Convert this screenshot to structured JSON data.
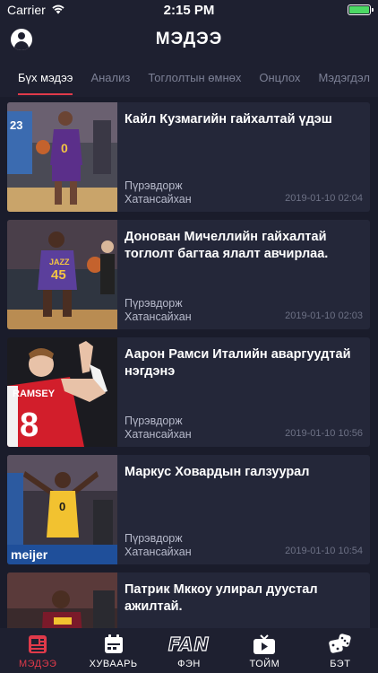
{
  "status": {
    "carrier": "Carrier",
    "time": "2:15 PM"
  },
  "header": {
    "title": "МЭДЭЭ"
  },
  "tabs": [
    {
      "label": "Бүх мэдээ"
    },
    {
      "label": "Анализ"
    },
    {
      "label": "Тоглолтын өмнөх"
    },
    {
      "label": "Онцлох"
    },
    {
      "label": "Мэдэгдэл"
    }
  ],
  "feed": [
    {
      "title": "Кайл Кузмагийн гайхалтай үдэш",
      "author_1": "Пүрэвдорж",
      "author_2": "Хатансайхан",
      "date": "2019-01-10 02:04"
    },
    {
      "title": "Донован Мичеллийн гайхалтай тоглолт багтаа ялалт авчирлаа.",
      "author_1": "Пүрэвдорж",
      "author_2": "Хатансайхан",
      "date": "2019-01-10 02:03"
    },
    {
      "title": "Аарон Рамси Италийн аваргуудтай нэгдэнэ",
      "author_1": "Пүрэвдорж",
      "author_2": "Хатансайхан",
      "date": "2019-01-10 10:56"
    },
    {
      "title": "Маркус Ховардын галзуурал",
      "author_1": "Пүрэвдорж",
      "author_2": "Хатансайхан",
      "date": "2019-01-10 10:54"
    },
    {
      "title": "Патрик Мккоу улирал дуустал ажилтай.",
      "author_1": "",
      "author_2": "",
      "date": ""
    }
  ],
  "thumbs": {
    "card_1": {
      "jersey_number": "0"
    },
    "card_2": {
      "jersey_team": "JAZZ",
      "jersey_number": "45"
    },
    "card_3": {
      "jersey_name": "RAMSEY",
      "jersey_number": "8"
    },
    "card_4": {
      "jersey_number": "0",
      "banner": "meijer"
    }
  },
  "tabbar": [
    {
      "label": "МЭДЭЭ",
      "icon": "news-icon"
    },
    {
      "label": "ХУВААРЬ",
      "icon": "calendar-icon"
    },
    {
      "label": "ФЭН",
      "icon": "fan-icon",
      "icon_text": "FAN"
    },
    {
      "label": "ТОЙМ",
      "icon": "video-icon"
    },
    {
      "label": "БЭТ",
      "icon": "dice-icon"
    }
  ],
  "colors": {
    "accent": "#e03a4a",
    "background": "#1a1c2b",
    "card": "#242739",
    "bar": "#1e2030",
    "battery": "#4cd964"
  }
}
